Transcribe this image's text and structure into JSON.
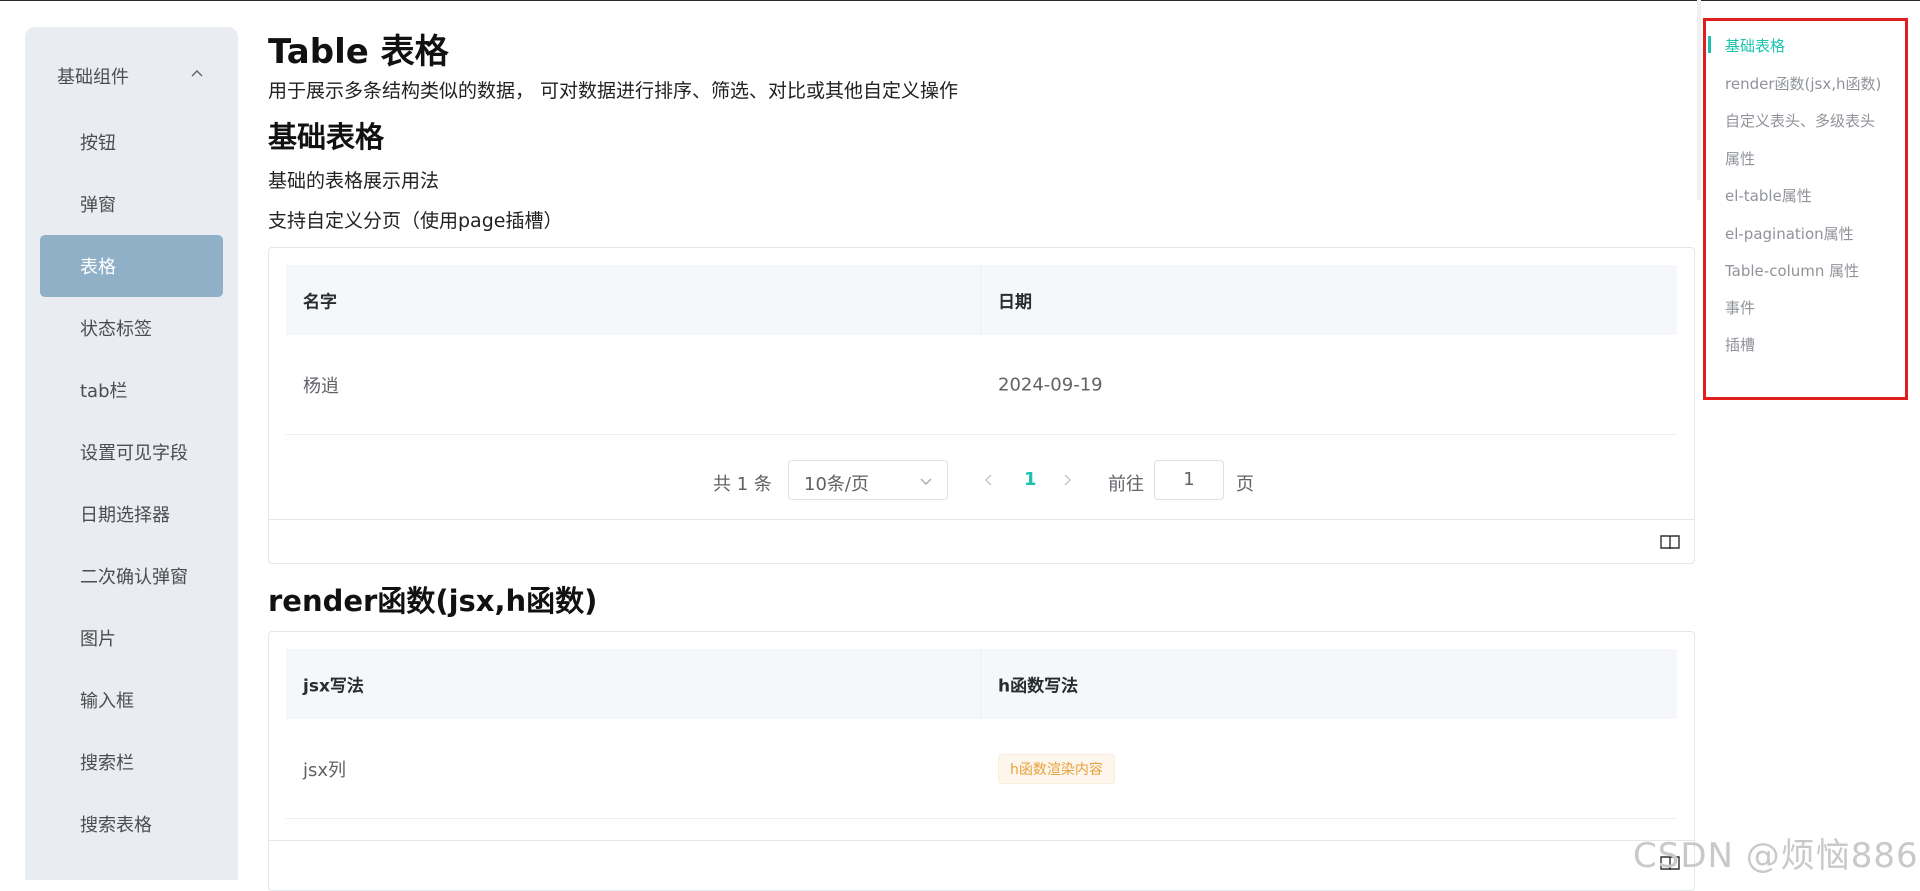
{
  "sidebar": {
    "group_label": "基础组件",
    "items": [
      {
        "label": "按钮"
      },
      {
        "label": "弹窗"
      },
      {
        "label": "表格"
      },
      {
        "label": "状态标签"
      },
      {
        "label": "tab栏"
      },
      {
        "label": "设置可见字段"
      },
      {
        "label": "日期选择器"
      },
      {
        "label": "二次确认弹窗"
      },
      {
        "label": "图片"
      },
      {
        "label": "输入框"
      },
      {
        "label": "搜索栏"
      },
      {
        "label": "搜索表格"
      }
    ],
    "active_index": 2
  },
  "page": {
    "title": "Table 表格",
    "description": "用于展示多条结构类似的数据， 可对数据进行排序、筛选、对比或其他自定义操作"
  },
  "basic": {
    "title": "基础表格",
    "para1": "基础的表格展示用法",
    "para2": "支持自定义分页（使用page插槽）",
    "table": {
      "headers": [
        "名字",
        "日期"
      ],
      "rows": [
        [
          "杨逍",
          "2024-09-19"
        ]
      ]
    },
    "pagination": {
      "total": "共 1 条",
      "page_size": "10条/页",
      "current_page": "1",
      "goto_label": "前往",
      "goto_value": "1",
      "page_label": "页"
    }
  },
  "render": {
    "title": "render函数(jsx,h函数)",
    "table": {
      "headers": [
        "jsx写法",
        "h函数写法"
      ],
      "row_jsx": "jsx列",
      "row_tag": "h函数渲染内容"
    }
  },
  "toc": {
    "items": [
      "基础表格",
      "render函数(jsx,h函数)",
      "自定义表头、多级表头",
      "属性",
      "el-table属性",
      "el-pagination属性",
      "Table-column 属性",
      "事件",
      "插槽"
    ],
    "active_index": 0
  },
  "watermark": "CSDN @烦恼886",
  "colors": {
    "accent": "#1dc2ae",
    "sidebar_active": "#8fb0c7",
    "toc_highlight_border": "#e01e1e",
    "tag_orange": "#e6a23c"
  }
}
